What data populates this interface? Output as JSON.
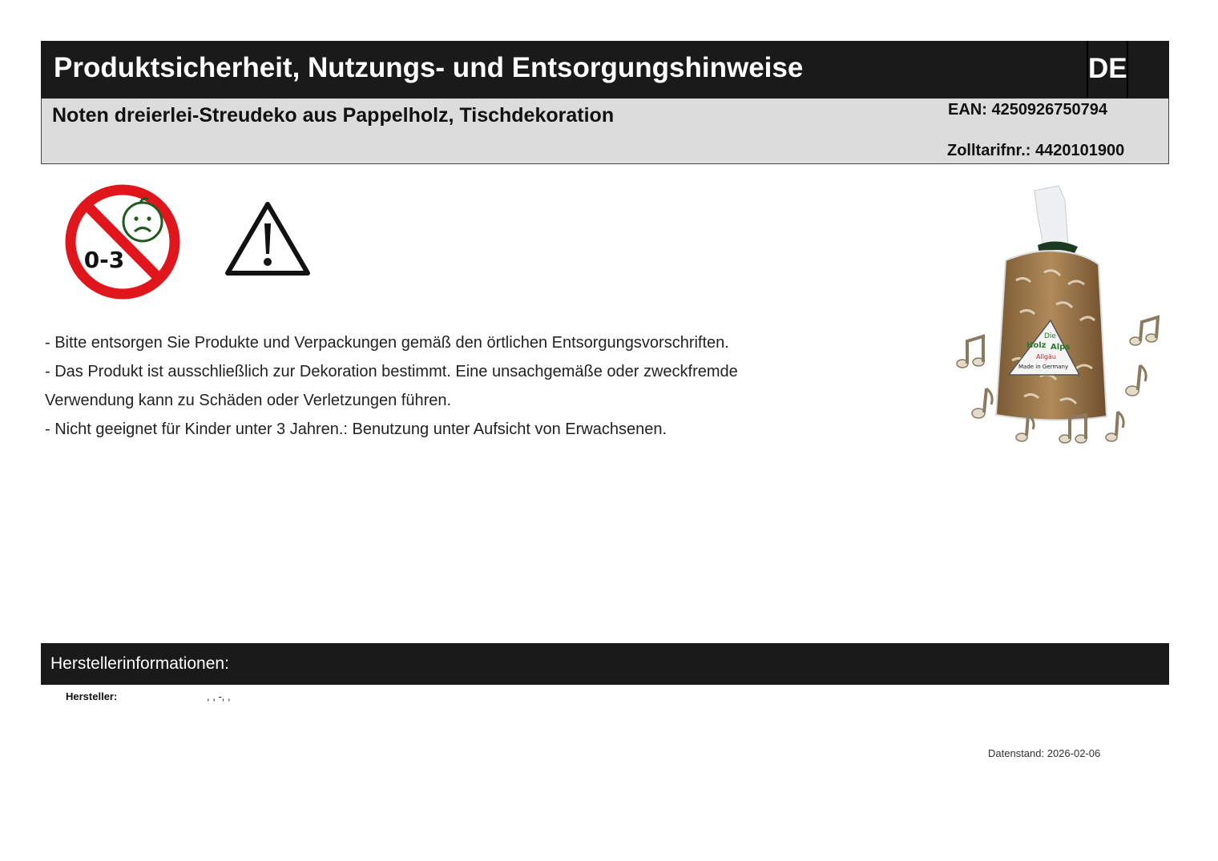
{
  "header": {
    "title": "Produktsicherheit, Nutzungs- und Entsorgungshinweise",
    "language": "DE"
  },
  "product": {
    "name": "Noten dreierlei-Streudeko aus Pappelholz, Tischdekoration",
    "ean": "EAN: 4250926750794",
    "tariff": "Zolltarifnr.: 4420101900"
  },
  "icons": {
    "age_warning": {
      "icon": "no-children-0-3-icon",
      "label": "0-3",
      "color": "#e0161c"
    },
    "general_warning": {
      "icon": "warning-triangle-icon"
    }
  },
  "product_image": {
    "logo_lines": [
      "Die",
      "Holz",
      "Alps",
      "Allgäu",
      "Made in Germany"
    ]
  },
  "notes": [
    "- Bitte entsorgen Sie Produkte und Verpackungen gemäß den örtlichen Entsorgungsvorschriften.",
    "- Das Produkt ist ausschließlich zur Dekoration bestimmt. Eine unsachgemäße oder zweckfremde",
    "Verwendung kann zu Schäden oder Verletzungen führen.",
    "- Nicht geeignet für Kinder unter 3 Jahren.: Benutzung unter Aufsicht von Erwachsenen."
  ],
  "manufacturer": {
    "section_title": "Herstellerinformationen:",
    "label": "Hersteller:",
    "value": ", ,  -, ,"
  },
  "footer": {
    "datestamp": "Datenstand: 2026-02-06"
  }
}
